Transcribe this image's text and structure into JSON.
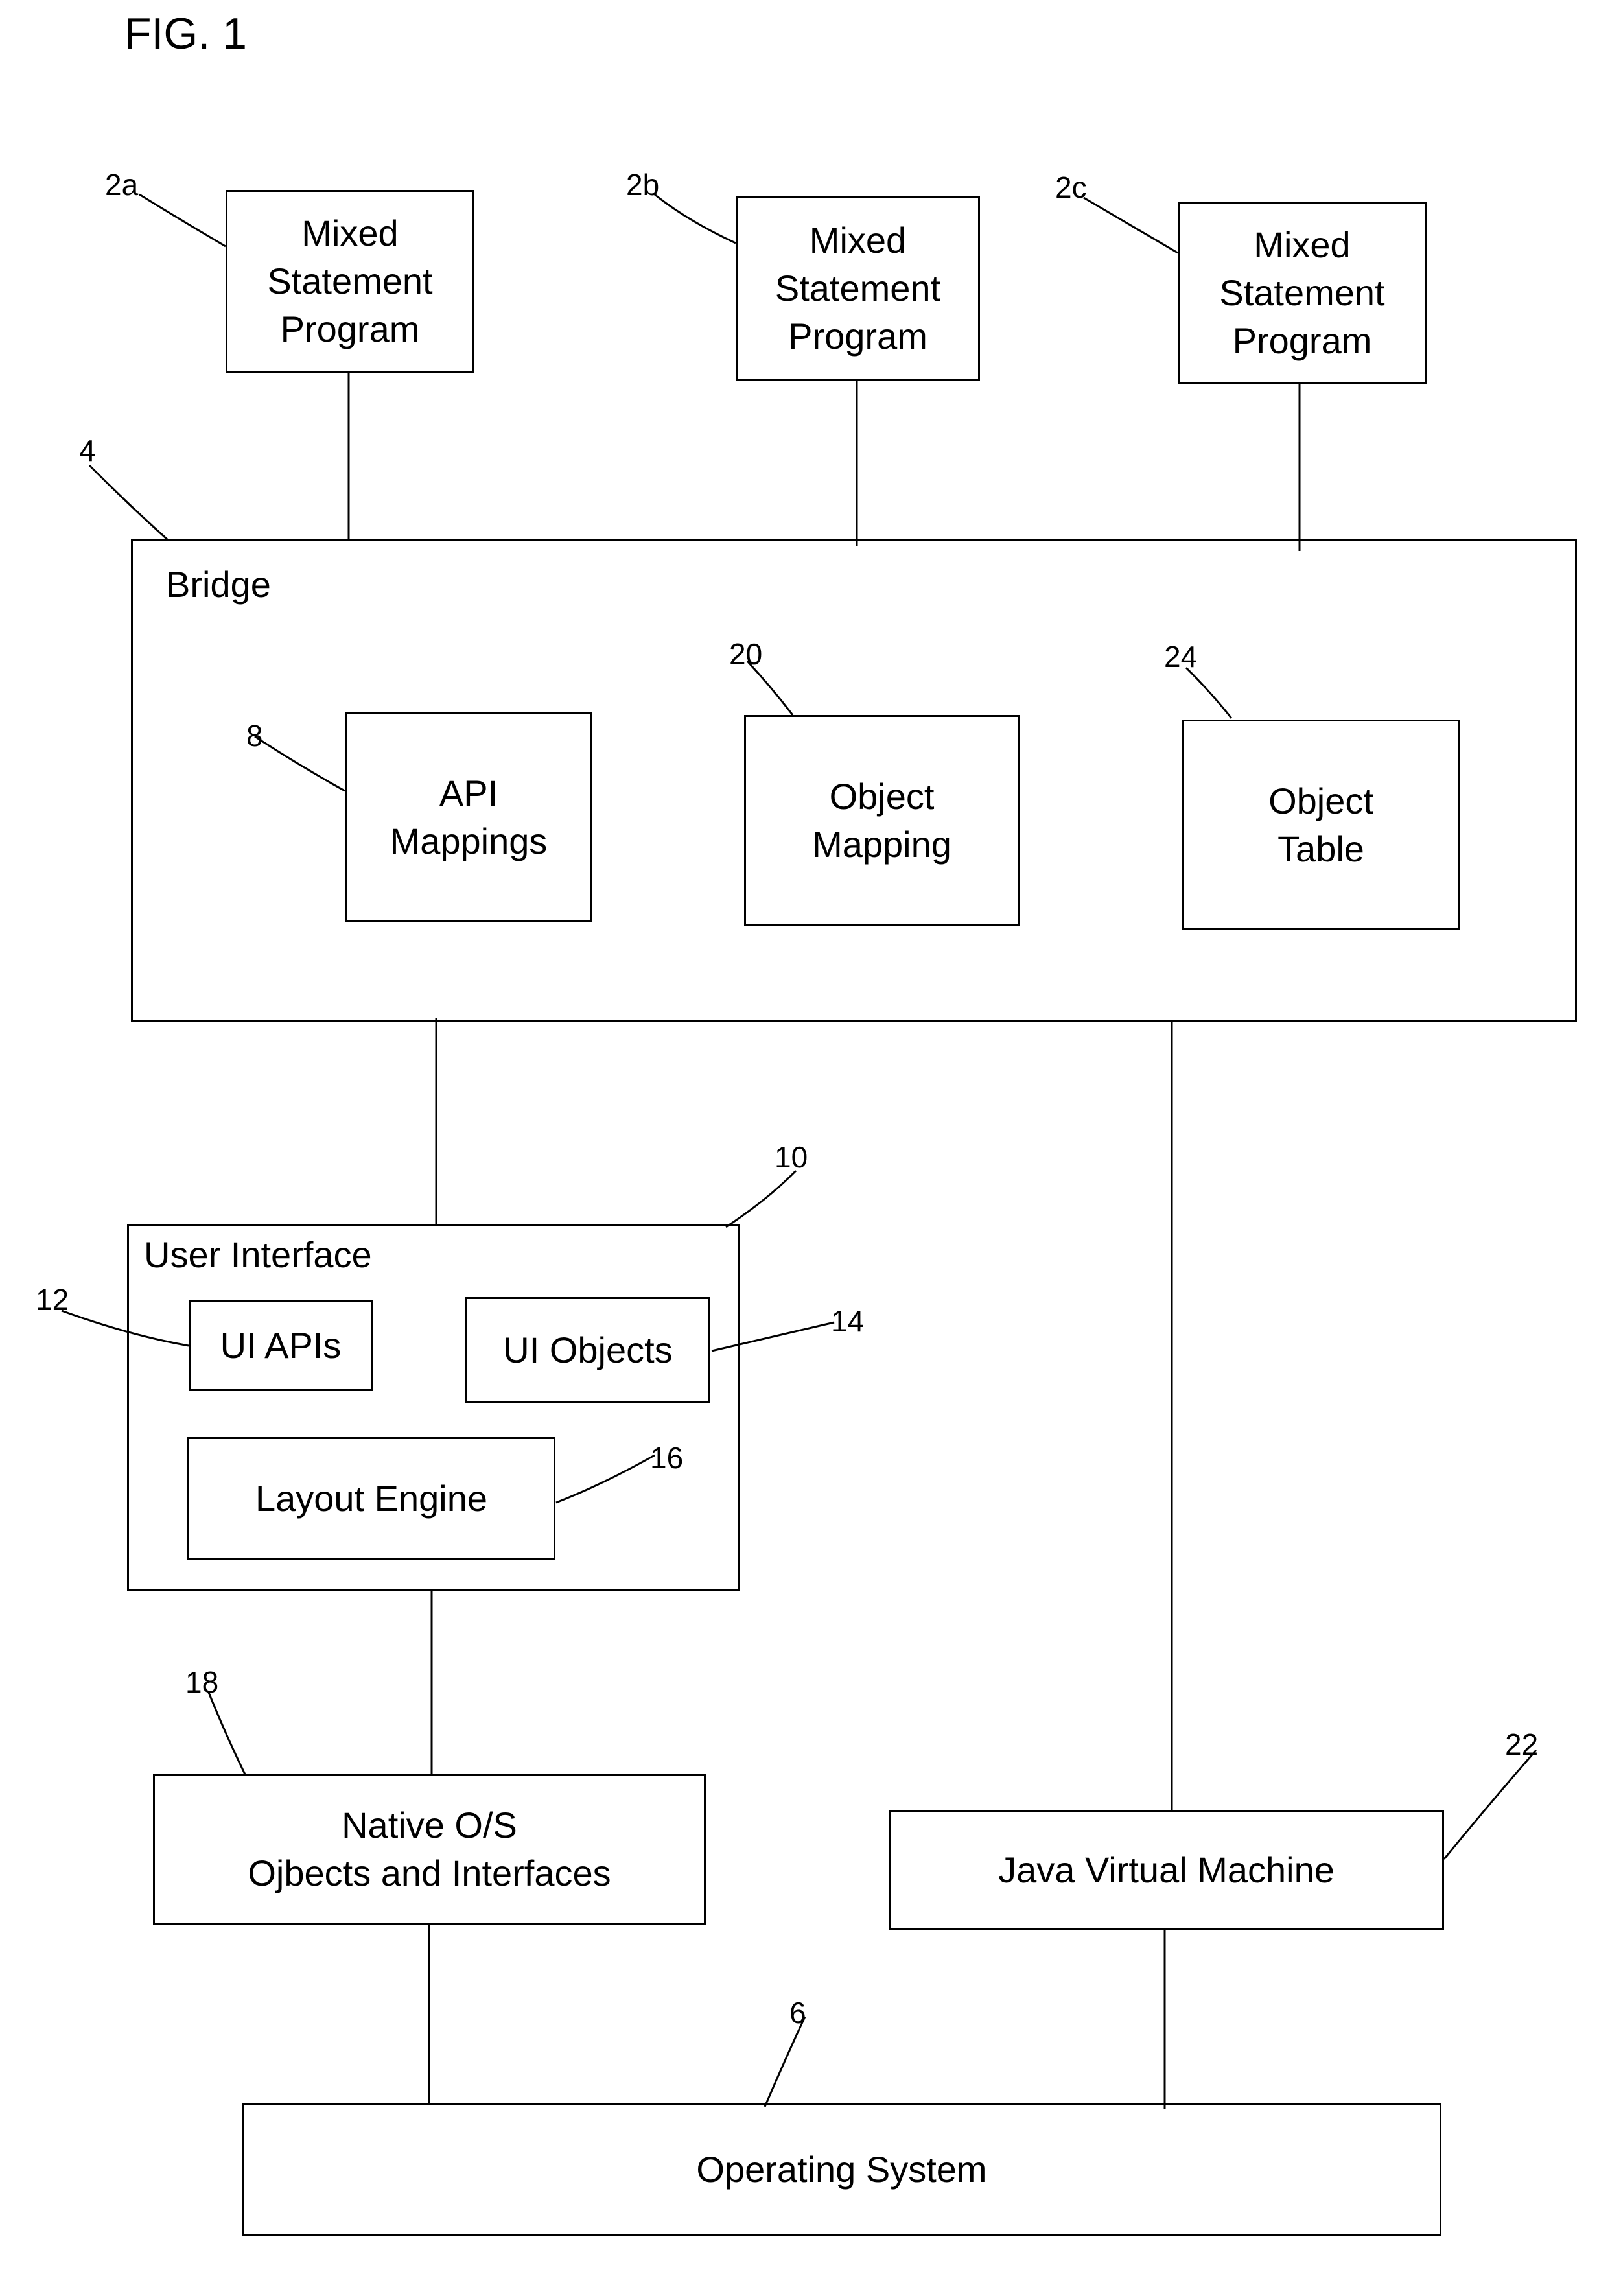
{
  "figure": {
    "title": "FIG. 1"
  },
  "programs": [
    {
      "ref": "2a",
      "lines": [
        "Mixed",
        "Statement",
        "Program"
      ]
    },
    {
      "ref": "2b",
      "lines": [
        "Mixed",
        "Statement",
        "Program"
      ]
    },
    {
      "ref": "2c",
      "lines": [
        "Mixed",
        "Statement",
        "Program"
      ]
    }
  ],
  "bridge": {
    "ref": "4",
    "title": "Bridge",
    "components": [
      {
        "ref": "8",
        "lines": [
          "API",
          "Mappings"
        ]
      },
      {
        "ref": "20",
        "lines": [
          "Object",
          "Mapping"
        ]
      },
      {
        "ref": "24",
        "lines": [
          "Object",
          "Table"
        ]
      }
    ]
  },
  "user_interface": {
    "ref": "10",
    "title": "User Interface",
    "ui_apis": {
      "ref": "12",
      "label": "UI APIs"
    },
    "ui_objects": {
      "ref": "14",
      "label": "UI Objects"
    },
    "layout_engine": {
      "ref": "16",
      "label": "Layout Engine"
    }
  },
  "native_os": {
    "ref": "18",
    "lines": [
      "Native O/S",
      "Ojbects and Interfaces"
    ]
  },
  "jvm": {
    "ref": "22",
    "label": "Java Virtual Machine"
  },
  "operating_system": {
    "ref": "6",
    "label": "Operating System"
  }
}
